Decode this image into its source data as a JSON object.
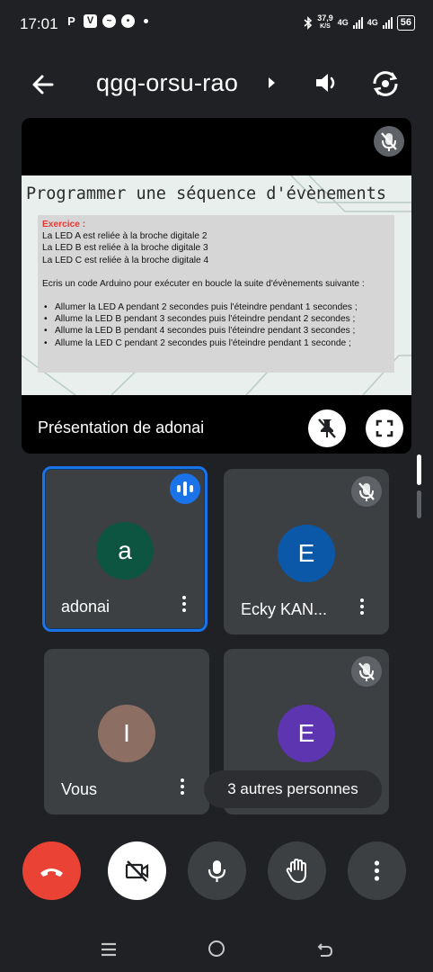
{
  "status_bar": {
    "time": "17:01",
    "app_icons": [
      "P",
      "V",
      "messenger-icon",
      "chat-icon"
    ],
    "speed": "37,9",
    "speed_unit": "K/S",
    "network1": "4G",
    "network2": "4G",
    "battery": "56"
  },
  "header": {
    "meeting_code": "qgq-orsu-rao"
  },
  "presentation": {
    "label": "Présentation de adonai",
    "slide": {
      "title": "Programmer une séquence d'évènements",
      "exercise_label": "Exercice :",
      "lines": [
        "La LED A est reliée à la broche digitale 2",
        "La LED B est reliée à la broche digitale 3",
        "La LED C est reliée à la broche digitale 4"
      ],
      "instruction": "Ecris un code Arduino pour exécuter en boucle la suite d'évènements suivante :",
      "bullets": [
        "Allumer la LED A pendant 2 secondes puis l'éteindre pendant 1 secondes ;",
        "Allume la LED B pendant 3 secondes puis l'éteindre pendant 2 secondes ;",
        "Allume la LED B pendant 4 secondes puis l'éteindre pendant 3 secondes ;",
        "Allume la LED C pendant  2 secondes puis l'éteindre pendant 1 seconde ;"
      ]
    }
  },
  "participants": [
    {
      "initial": "a",
      "name": "adonai",
      "avatar_color": "#0d5441",
      "speaking": true
    },
    {
      "initial": "E",
      "name": "Ecky KAN...",
      "avatar_color": "#0b57a8",
      "muted": true
    },
    {
      "initial": "I",
      "name": "Vous",
      "avatar_color": "#8d6e63"
    },
    {
      "initial": "E",
      "avatar_color": "#5e35b1",
      "muted": true
    }
  ],
  "others_label": "3 autres personnes",
  "colors": {
    "background": "#202124",
    "tile": "#3c4043",
    "end_call": "#ea4335",
    "speaking_border": "#1a73e8"
  }
}
